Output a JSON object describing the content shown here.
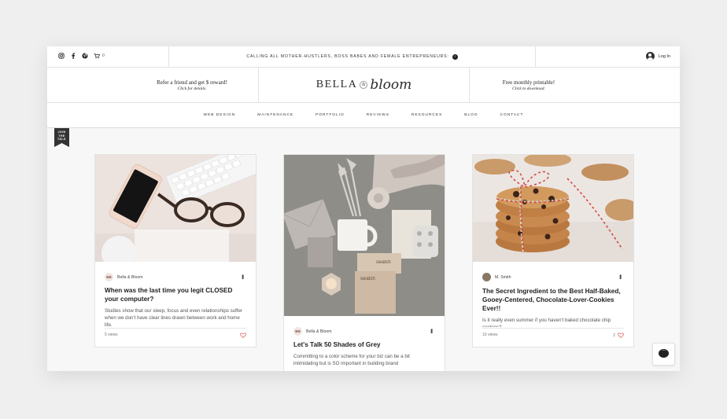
{
  "topbar": {
    "cart_count": "0",
    "announcement": "CALLING ALL MOTHER-HUSTLERS, BOSS BABES AND FEMALE ENTREPRENEURS:",
    "login_label": "Log In"
  },
  "header": {
    "left_promo_title": "Refer a friend and get $ reward!",
    "left_promo_sub": "Click for details.",
    "logo_part1": "BELLA",
    "logo_amp": "&",
    "logo_part2": "bloom",
    "right_promo_title": "Free monthly printable!",
    "right_promo_sub": "Click to download."
  },
  "nav": {
    "items": [
      "WEB DESIGN",
      "MAINTENANCE",
      "PORTFOLIO",
      "REVIEWS",
      "RESOURCES",
      "BLOG",
      "CONTACT"
    ]
  },
  "ribbon": {
    "line1": "JOIN",
    "line2": "THE",
    "line3": "TALK"
  },
  "posts": [
    {
      "author": "Bella & Bloom",
      "avatar_text": "BB",
      "title": "When was the last time you legit CLOSED your computer?",
      "excerpt": "Studies show that our sleep, focus and even relationships suffer when we don't have clear lines drawn between work and home life.",
      "views": "5 views",
      "likes": ""
    },
    {
      "author": "Bella & Bloom",
      "avatar_text": "BB",
      "title": "Let's Talk 50 Shades of Grey",
      "excerpt": "Committing to a color scheme for your biz can be a bit intimidating but is SO important in building brand",
      "swatch1": "swatch",
      "swatch2": "swatch"
    },
    {
      "author": "M. Smith",
      "title": "The Secret Ingredient to the Best Half-Baked, Gooey-Centered, Chocolate-Lover-Cookies Ever!!",
      "excerpt": "Is it really even summer if you haven't baked chocolate chip cookies?",
      "views": "10 views",
      "likes": "2"
    }
  ],
  "colors": {
    "accent": "#d9534f",
    "ribbon": "#333333",
    "frame": "#f7f7f7"
  }
}
